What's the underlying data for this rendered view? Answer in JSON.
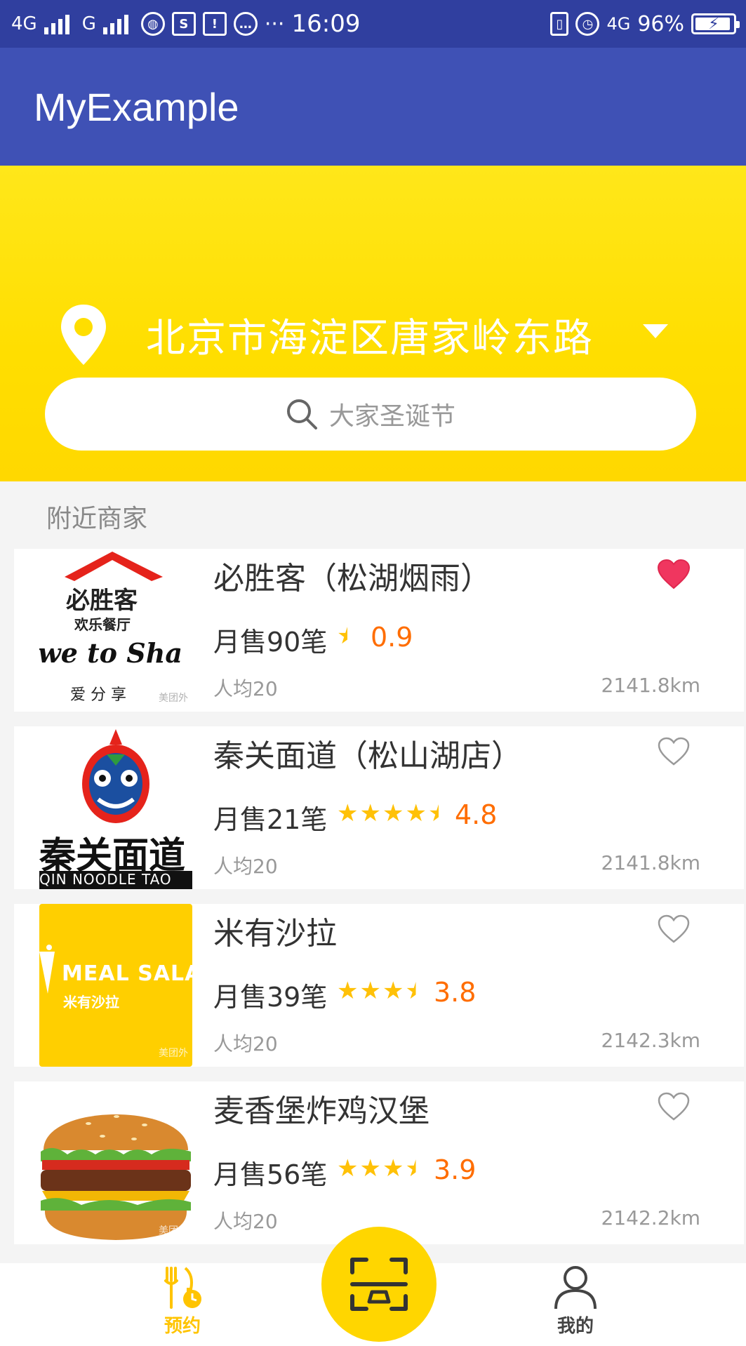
{
  "status_bar": {
    "network1": "4G",
    "network2": "G",
    "time": "16:09",
    "right_network": "4G",
    "battery": "96%"
  },
  "app_bar": {
    "title": "MyExample"
  },
  "header": {
    "location": "北京市海淀区唐家岭东路",
    "search_placeholder": "大家圣诞节"
  },
  "section_title": "附近商家",
  "shops": [
    {
      "name": "必胜客（松湖烟雨）",
      "sales": "月售90笔",
      "rating": "0.9",
      "stars": 0.5,
      "avg": "人均20",
      "distance": "2141.8km",
      "favorited": true,
      "logo": {
        "text1": "必胜客",
        "text2": "欢乐餐厅",
        "text3": "we to Sha",
        "text4": "爱 分 享"
      }
    },
    {
      "name": "秦关面道（松山湖店）",
      "sales": "月售21笔",
      "rating": "4.8",
      "stars": 4.5,
      "avg": "人均20",
      "distance": "2141.8km",
      "favorited": false,
      "logo": {
        "text1": "秦关面道",
        "text2": "QIN NOODLE TAO"
      }
    },
    {
      "name": "米有沙拉",
      "sales": "月售39笔",
      "rating": "3.8",
      "stars": 3.5,
      "avg": "人均20",
      "distance": "2142.3km",
      "favorited": false,
      "logo": {
        "text1": "MEAL SALAD",
        "text2": "米有沙拉"
      }
    },
    {
      "name": "麦香堡炸鸡汉堡",
      "sales": "月售56笔",
      "rating": "3.9",
      "stars": 3.5,
      "avg": "人均20",
      "distance": "2142.2km",
      "favorited": false,
      "logo": {}
    }
  ],
  "watermark": "美团外",
  "bottom_nav": {
    "tabs": [
      {
        "label": "预约",
        "icon": "cutlery-clock-icon",
        "active": true
      },
      {
        "label": "我的",
        "icon": "person-icon",
        "active": false
      }
    ],
    "center_icon": "scan-icon"
  },
  "colors": {
    "primary": "#3f51b5",
    "primary_dark": "#303f9f",
    "accent": "#ffd600",
    "rating": "#ff6d00",
    "star": "#ffc107"
  }
}
